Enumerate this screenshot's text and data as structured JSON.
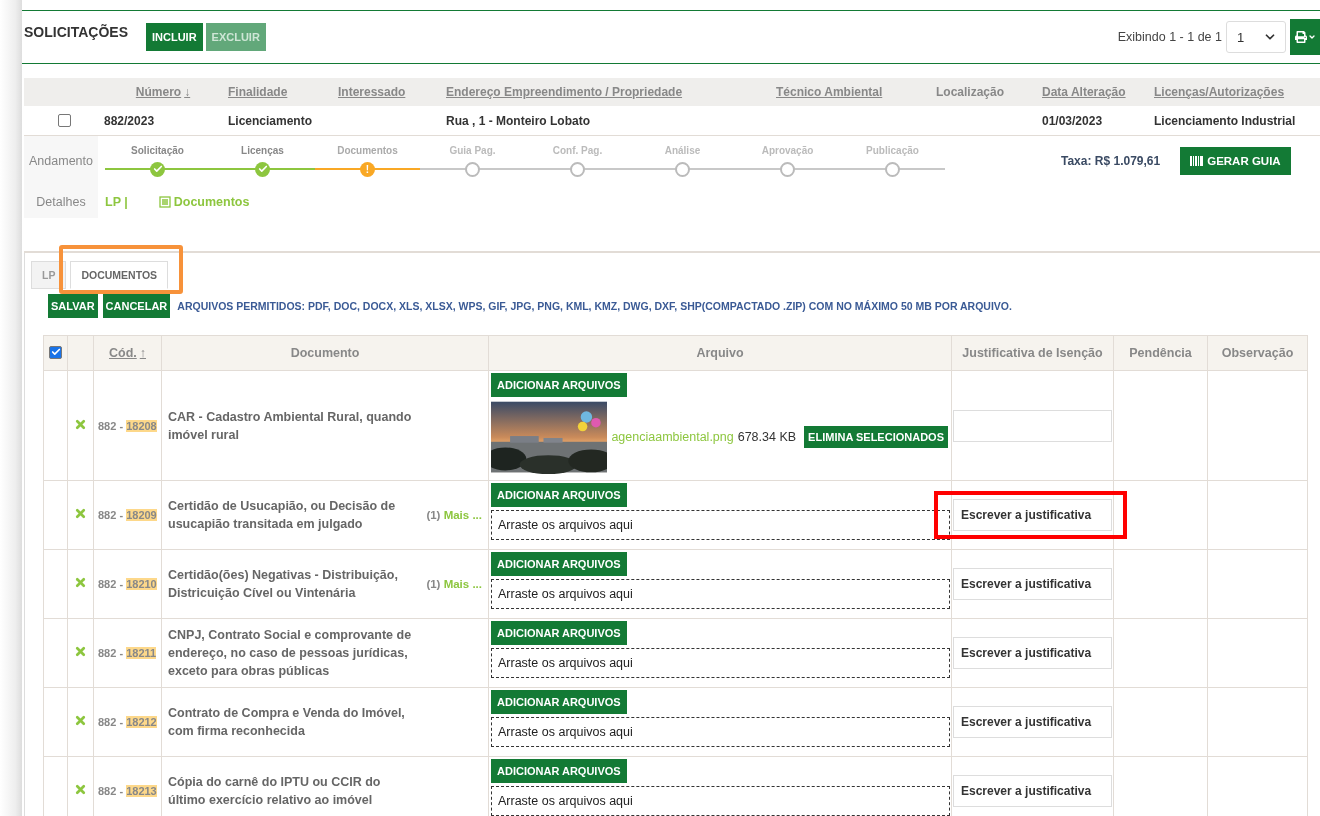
{
  "header": {
    "title": "SOLICITAÇÕES",
    "buttons": [
      {
        "label": "INCLUIR",
        "disabled": false
      },
      {
        "label": "EXCLUIR",
        "disabled": true
      }
    ],
    "paging": "Exibindo 1 - 1 de 1",
    "page_select": {
      "value": "1"
    }
  },
  "requests": {
    "columns": [
      {
        "label": "Número",
        "sortable": true,
        "sort_arrow": "↓"
      },
      {
        "label": "Finalidade",
        "sortable": true
      },
      {
        "label": "Interessado",
        "sortable": true
      },
      {
        "label": "Endereço Empreendimento / Propriedade",
        "sortable": true
      },
      {
        "label": "Técnico Ambiental",
        "sortable": true
      },
      {
        "label": "Localização",
        "sortable": false
      },
      {
        "label": "Data Alteração",
        "sortable": true
      },
      {
        "label": "Licenças/Autorizações",
        "sortable": true
      }
    ],
    "rows": [
      {
        "checked": false,
        "cells": [
          "882/2023",
          "Licenciamento",
          "",
          "Rua , 1 - Monteiro Lobato",
          "",
          "",
          "01/03/2023",
          "Licenciamento Industrial"
        ]
      }
    ]
  },
  "progress": {
    "label": "Andamento",
    "steps": [
      {
        "label": "Solicitação",
        "kind": "done"
      },
      {
        "label": "Licenças",
        "kind": "done"
      },
      {
        "label": "Documentos",
        "kind": "warning",
        "mark": "!"
      },
      {
        "label": "Guia Pag.",
        "kind": "pending"
      },
      {
        "label": "Conf. Pag.",
        "kind": "pending"
      },
      {
        "label": "Análise",
        "kind": "pending"
      },
      {
        "label": "Aprovação",
        "kind": "pending"
      },
      {
        "label": "Publicação",
        "kind": "pending"
      }
    ],
    "fee": "Taxa: R$ 1.079,61",
    "button": "GERAR GUIA"
  },
  "details": {
    "label": "Detalhes",
    "links": [
      {
        "label": "LP |",
        "kind": "text"
      },
      {
        "label": "Documentos",
        "kind": "document"
      }
    ]
  },
  "tabs": [
    {
      "label": "LP",
      "selected": false,
      "highlighted": false
    },
    {
      "label": "DOCUMENTOS",
      "selected": true,
      "highlighted": true
    }
  ],
  "toolbar": {
    "buttons": [
      "SALVAR",
      "CANCELAR"
    ],
    "note": "ARQUIVOS PERMITIDOS: PDF, DOC, DOCX, XLS, XLSX, WPS, GIF, JPG, PNG, KML, KMZ, DWG, DXF, SHP(COMPACTADO .ZIP) COM NO MÁXIMO 50 MB POR ARQUIVO."
  },
  "documents": {
    "all_checked": true,
    "columns": [
      {
        "label": "Cód.",
        "sortable": true,
        "sort_arrow": "↑"
      },
      {
        "label": "Documento",
        "sortable": false
      },
      {
        "label": "Arquivo",
        "sortable": false
      },
      {
        "label": "Justificativa de Isenção",
        "sortable": false
      },
      {
        "label": "Pendência",
        "sortable": false
      },
      {
        "label": "Observação",
        "sortable": false
      }
    ],
    "rows": [
      {
        "missing": true,
        "code_prefix": "882 - ",
        "code": "18208",
        "name": "CAR - Cadastro Ambiental Rural, quando imóvel rural",
        "add_button": "ADICIONAR ARQUIVOS",
        "file": {
          "kind": "picture",
          "name": "agenciaambiental.png",
          "size": "678.34 KB",
          "delete_button": "ELIMINA SELECIONADOS"
        },
        "justification": {
          "highlighted": false
        }
      },
      {
        "missing": true,
        "code_prefix": "882 - ",
        "code": "18209",
        "name": "Certidão de Usucapião, ou Decisão de usucapião transitada em julgado",
        "more_count": "(1)",
        "more_link": "Mais ...",
        "add_button": "ADICIONAR ARQUIVOS",
        "drop_zone": "Arraste os arquivos aqui",
        "justification": {
          "placeholder": "Escrever a justificativa",
          "highlighted": true
        }
      },
      {
        "missing": true,
        "code_prefix": "882 - ",
        "code": "18210",
        "name": "Certidão(ões) Negativas - Distribuição, Districuição Cível ou Vintenária",
        "more_count": "(1)",
        "more_link": "Mais ...",
        "add_button": "ADICIONAR ARQUIVOS",
        "drop_zone": "Arraste os arquivos aqui",
        "justification": {
          "placeholder": "Escrever a justificativa",
          "highlighted": false
        }
      },
      {
        "missing": true,
        "code_prefix": "882 - ",
        "code": "18211",
        "name": "CNPJ, Contrato Social e comprovante de endereço, no caso de pessoas jurídicas, exceto para obras públicas",
        "add_button": "ADICIONAR ARQUIVOS",
        "drop_zone": "Arraste os arquivos aqui",
        "justification": {
          "placeholder": "Escrever a justificativa",
          "highlighted": false
        }
      },
      {
        "missing": true,
        "code_prefix": "882 - ",
        "code": "18212",
        "name": "Contrato de Compra e Venda do Imóvel, com firma reconhecida",
        "add_button": "ADICIONAR ARQUIVOS",
        "drop_zone": "Arraste os arquivos aqui",
        "justification": {
          "placeholder": "Escrever a justificativa",
          "highlighted": false
        }
      },
      {
        "missing": true,
        "code_prefix": "882 - ",
        "code": "18213",
        "name": "Cópia do carnê do IPTU ou CCIR do último exercício relativo ao imóvel",
        "add_button": "ADICIONAR ARQUIVOS",
        "drop_zone": "Arraste os arquivos aqui",
        "justification": {
          "placeholder": "Escrever a justificativa",
          "highlighted": false
        }
      }
    ]
  }
}
